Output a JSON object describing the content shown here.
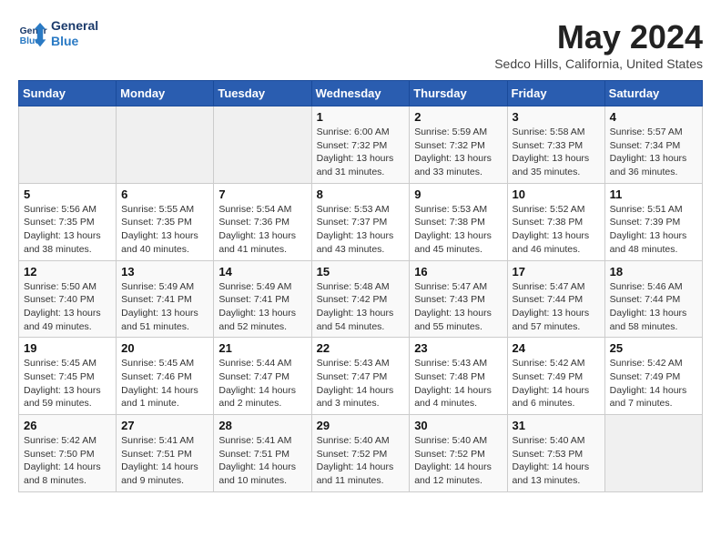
{
  "header": {
    "logo_line1": "General",
    "logo_line2": "Blue",
    "month": "May 2024",
    "location": "Sedco Hills, California, United States"
  },
  "weekdays": [
    "Sunday",
    "Monday",
    "Tuesday",
    "Wednesday",
    "Thursday",
    "Friday",
    "Saturday"
  ],
  "weeks": [
    [
      {
        "day": "",
        "info": ""
      },
      {
        "day": "",
        "info": ""
      },
      {
        "day": "",
        "info": ""
      },
      {
        "day": "1",
        "info": "Sunrise: 6:00 AM\nSunset: 7:32 PM\nDaylight: 13 hours\nand 31 minutes."
      },
      {
        "day": "2",
        "info": "Sunrise: 5:59 AM\nSunset: 7:32 PM\nDaylight: 13 hours\nand 33 minutes."
      },
      {
        "day": "3",
        "info": "Sunrise: 5:58 AM\nSunset: 7:33 PM\nDaylight: 13 hours\nand 35 minutes."
      },
      {
        "day": "4",
        "info": "Sunrise: 5:57 AM\nSunset: 7:34 PM\nDaylight: 13 hours\nand 36 minutes."
      }
    ],
    [
      {
        "day": "5",
        "info": "Sunrise: 5:56 AM\nSunset: 7:35 PM\nDaylight: 13 hours\nand 38 minutes."
      },
      {
        "day": "6",
        "info": "Sunrise: 5:55 AM\nSunset: 7:35 PM\nDaylight: 13 hours\nand 40 minutes."
      },
      {
        "day": "7",
        "info": "Sunrise: 5:54 AM\nSunset: 7:36 PM\nDaylight: 13 hours\nand 41 minutes."
      },
      {
        "day": "8",
        "info": "Sunrise: 5:53 AM\nSunset: 7:37 PM\nDaylight: 13 hours\nand 43 minutes."
      },
      {
        "day": "9",
        "info": "Sunrise: 5:53 AM\nSunset: 7:38 PM\nDaylight: 13 hours\nand 45 minutes."
      },
      {
        "day": "10",
        "info": "Sunrise: 5:52 AM\nSunset: 7:38 PM\nDaylight: 13 hours\nand 46 minutes."
      },
      {
        "day": "11",
        "info": "Sunrise: 5:51 AM\nSunset: 7:39 PM\nDaylight: 13 hours\nand 48 minutes."
      }
    ],
    [
      {
        "day": "12",
        "info": "Sunrise: 5:50 AM\nSunset: 7:40 PM\nDaylight: 13 hours\nand 49 minutes."
      },
      {
        "day": "13",
        "info": "Sunrise: 5:49 AM\nSunset: 7:41 PM\nDaylight: 13 hours\nand 51 minutes."
      },
      {
        "day": "14",
        "info": "Sunrise: 5:49 AM\nSunset: 7:41 PM\nDaylight: 13 hours\nand 52 minutes."
      },
      {
        "day": "15",
        "info": "Sunrise: 5:48 AM\nSunset: 7:42 PM\nDaylight: 13 hours\nand 54 minutes."
      },
      {
        "day": "16",
        "info": "Sunrise: 5:47 AM\nSunset: 7:43 PM\nDaylight: 13 hours\nand 55 minutes."
      },
      {
        "day": "17",
        "info": "Sunrise: 5:47 AM\nSunset: 7:44 PM\nDaylight: 13 hours\nand 57 minutes."
      },
      {
        "day": "18",
        "info": "Sunrise: 5:46 AM\nSunset: 7:44 PM\nDaylight: 13 hours\nand 58 minutes."
      }
    ],
    [
      {
        "day": "19",
        "info": "Sunrise: 5:45 AM\nSunset: 7:45 PM\nDaylight: 13 hours\nand 59 minutes."
      },
      {
        "day": "20",
        "info": "Sunrise: 5:45 AM\nSunset: 7:46 PM\nDaylight: 14 hours\nand 1 minute."
      },
      {
        "day": "21",
        "info": "Sunrise: 5:44 AM\nSunset: 7:47 PM\nDaylight: 14 hours\nand 2 minutes."
      },
      {
        "day": "22",
        "info": "Sunrise: 5:43 AM\nSunset: 7:47 PM\nDaylight: 14 hours\nand 3 minutes."
      },
      {
        "day": "23",
        "info": "Sunrise: 5:43 AM\nSunset: 7:48 PM\nDaylight: 14 hours\nand 4 minutes."
      },
      {
        "day": "24",
        "info": "Sunrise: 5:42 AM\nSunset: 7:49 PM\nDaylight: 14 hours\nand 6 minutes."
      },
      {
        "day": "25",
        "info": "Sunrise: 5:42 AM\nSunset: 7:49 PM\nDaylight: 14 hours\nand 7 minutes."
      }
    ],
    [
      {
        "day": "26",
        "info": "Sunrise: 5:42 AM\nSunset: 7:50 PM\nDaylight: 14 hours\nand 8 minutes."
      },
      {
        "day": "27",
        "info": "Sunrise: 5:41 AM\nSunset: 7:51 PM\nDaylight: 14 hours\nand 9 minutes."
      },
      {
        "day": "28",
        "info": "Sunrise: 5:41 AM\nSunset: 7:51 PM\nDaylight: 14 hours\nand 10 minutes."
      },
      {
        "day": "29",
        "info": "Sunrise: 5:40 AM\nSunset: 7:52 PM\nDaylight: 14 hours\nand 11 minutes."
      },
      {
        "day": "30",
        "info": "Sunrise: 5:40 AM\nSunset: 7:52 PM\nDaylight: 14 hours\nand 12 minutes."
      },
      {
        "day": "31",
        "info": "Sunrise: 5:40 AM\nSunset: 7:53 PM\nDaylight: 14 hours\nand 13 minutes."
      },
      {
        "day": "",
        "info": ""
      }
    ]
  ]
}
